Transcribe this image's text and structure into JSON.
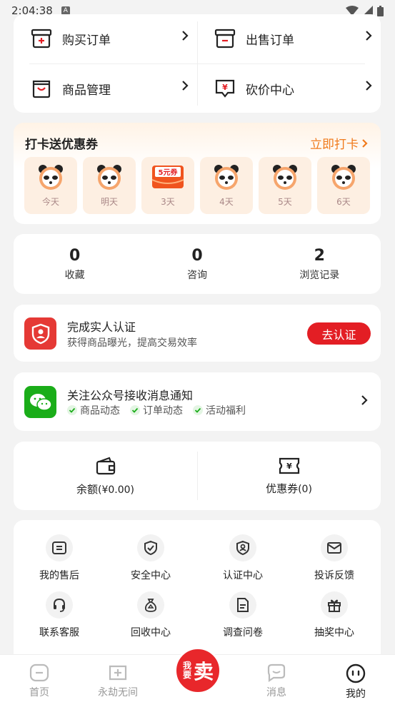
{
  "status_bar": {
    "time": "2:04:38",
    "notif_icon": "A"
  },
  "orders": [
    {
      "label": "购买订单",
      "icon": "buy-order-icon"
    },
    {
      "label": "出售订单",
      "icon": "sell-order-icon"
    },
    {
      "label": "商品管理",
      "icon": "goods-manage-icon"
    },
    {
      "label": "砍价中心",
      "icon": "bargain-icon"
    }
  ],
  "checkin": {
    "title": "打卡送优惠券",
    "action": "立即打卡",
    "days": [
      {
        "label": "今天",
        "icon": "panda-icon"
      },
      {
        "label": "明天",
        "icon": "panda-icon"
      },
      {
        "label": "3天",
        "icon": "coupon-icon",
        "coupon_text": "5元券"
      },
      {
        "label": "4天",
        "icon": "panda-icon"
      },
      {
        "label": "5天",
        "icon": "panda-icon"
      },
      {
        "label": "6天",
        "icon": "panda-icon"
      }
    ]
  },
  "stats": [
    {
      "num": "0",
      "label": "收藏"
    },
    {
      "num": "0",
      "label": "咨询"
    },
    {
      "num": "2",
      "label": "浏览记录"
    }
  ],
  "verify": {
    "title": "完成实人认证",
    "subtitle": "获得商品曝光，提高交易效率",
    "button": "去认证"
  },
  "wechat": {
    "title": "关注公众号接收消息通知",
    "tags": [
      "商品动态",
      "订单动态",
      "活动福利"
    ]
  },
  "wallet": {
    "balance_label": "余额",
    "balance_value": "(¥0.00)",
    "coupon_label": "优惠券",
    "coupon_value": "(0)"
  },
  "services": [
    {
      "label": "我的售后",
      "icon": "after-sale-icon"
    },
    {
      "label": "安全中心",
      "icon": "shield-icon"
    },
    {
      "label": "认证中心",
      "icon": "verify-shield-icon"
    },
    {
      "label": "投诉反馈",
      "icon": "complaint-icon"
    },
    {
      "label": "联系客服",
      "icon": "headset-icon"
    },
    {
      "label": "回收中心",
      "icon": "recycle-icon"
    },
    {
      "label": "调查问卷",
      "icon": "survey-icon"
    },
    {
      "label": "抽奖中心",
      "icon": "gift-icon"
    }
  ],
  "tabbar": {
    "tabs": [
      {
        "label": "首页",
        "icon": "home-icon"
      },
      {
        "label": "永劫无间",
        "icon": "game-icon"
      },
      {
        "label": "消息",
        "icon": "message-icon"
      },
      {
        "label": "我的",
        "icon": "profile-icon"
      }
    ],
    "sell_small": "我要",
    "sell_big": "卖"
  },
  "colors": {
    "accent_red": "#e31e24",
    "orange": "#f07b1d",
    "wechat_green": "#1aad19"
  }
}
